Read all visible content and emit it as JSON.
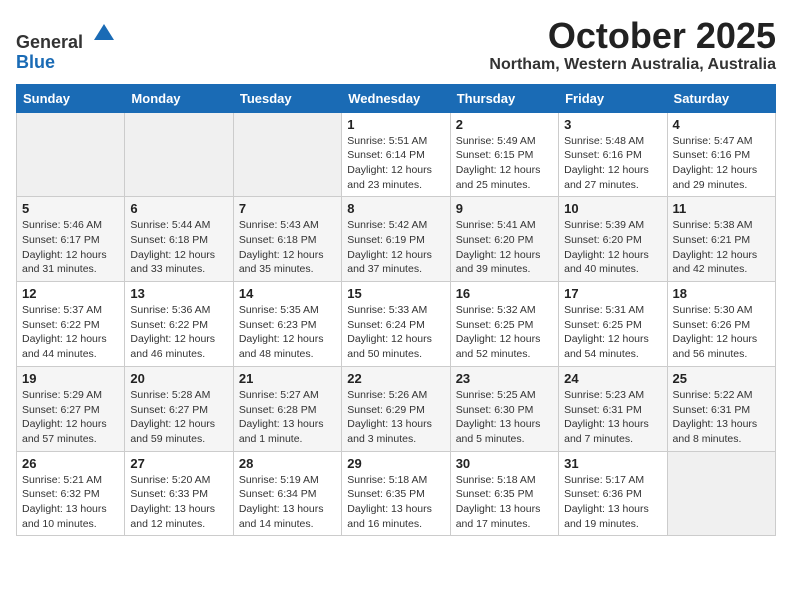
{
  "header": {
    "logo_line1": "General",
    "logo_line2": "Blue",
    "month": "October 2025",
    "location": "Northam, Western Australia, Australia"
  },
  "days_of_week": [
    "Sunday",
    "Monday",
    "Tuesday",
    "Wednesday",
    "Thursday",
    "Friday",
    "Saturday"
  ],
  "weeks": [
    [
      {
        "day": "",
        "info": ""
      },
      {
        "day": "",
        "info": ""
      },
      {
        "day": "",
        "info": ""
      },
      {
        "day": "1",
        "info": "Sunrise: 5:51 AM\nSunset: 6:14 PM\nDaylight: 12 hours\nand 23 minutes."
      },
      {
        "day": "2",
        "info": "Sunrise: 5:49 AM\nSunset: 6:15 PM\nDaylight: 12 hours\nand 25 minutes."
      },
      {
        "day": "3",
        "info": "Sunrise: 5:48 AM\nSunset: 6:16 PM\nDaylight: 12 hours\nand 27 minutes."
      },
      {
        "day": "4",
        "info": "Sunrise: 5:47 AM\nSunset: 6:16 PM\nDaylight: 12 hours\nand 29 minutes."
      }
    ],
    [
      {
        "day": "5",
        "info": "Sunrise: 5:46 AM\nSunset: 6:17 PM\nDaylight: 12 hours\nand 31 minutes."
      },
      {
        "day": "6",
        "info": "Sunrise: 5:44 AM\nSunset: 6:18 PM\nDaylight: 12 hours\nand 33 minutes."
      },
      {
        "day": "7",
        "info": "Sunrise: 5:43 AM\nSunset: 6:18 PM\nDaylight: 12 hours\nand 35 minutes."
      },
      {
        "day": "8",
        "info": "Sunrise: 5:42 AM\nSunset: 6:19 PM\nDaylight: 12 hours\nand 37 minutes."
      },
      {
        "day": "9",
        "info": "Sunrise: 5:41 AM\nSunset: 6:20 PM\nDaylight: 12 hours\nand 39 minutes."
      },
      {
        "day": "10",
        "info": "Sunrise: 5:39 AM\nSunset: 6:20 PM\nDaylight: 12 hours\nand 40 minutes."
      },
      {
        "day": "11",
        "info": "Sunrise: 5:38 AM\nSunset: 6:21 PM\nDaylight: 12 hours\nand 42 minutes."
      }
    ],
    [
      {
        "day": "12",
        "info": "Sunrise: 5:37 AM\nSunset: 6:22 PM\nDaylight: 12 hours\nand 44 minutes."
      },
      {
        "day": "13",
        "info": "Sunrise: 5:36 AM\nSunset: 6:22 PM\nDaylight: 12 hours\nand 46 minutes."
      },
      {
        "day": "14",
        "info": "Sunrise: 5:35 AM\nSunset: 6:23 PM\nDaylight: 12 hours\nand 48 minutes."
      },
      {
        "day": "15",
        "info": "Sunrise: 5:33 AM\nSunset: 6:24 PM\nDaylight: 12 hours\nand 50 minutes."
      },
      {
        "day": "16",
        "info": "Sunrise: 5:32 AM\nSunset: 6:25 PM\nDaylight: 12 hours\nand 52 minutes."
      },
      {
        "day": "17",
        "info": "Sunrise: 5:31 AM\nSunset: 6:25 PM\nDaylight: 12 hours\nand 54 minutes."
      },
      {
        "day": "18",
        "info": "Sunrise: 5:30 AM\nSunset: 6:26 PM\nDaylight: 12 hours\nand 56 minutes."
      }
    ],
    [
      {
        "day": "19",
        "info": "Sunrise: 5:29 AM\nSunset: 6:27 PM\nDaylight: 12 hours\nand 57 minutes."
      },
      {
        "day": "20",
        "info": "Sunrise: 5:28 AM\nSunset: 6:27 PM\nDaylight: 12 hours\nand 59 minutes."
      },
      {
        "day": "21",
        "info": "Sunrise: 5:27 AM\nSunset: 6:28 PM\nDaylight: 13 hours\nand 1 minute."
      },
      {
        "day": "22",
        "info": "Sunrise: 5:26 AM\nSunset: 6:29 PM\nDaylight: 13 hours\nand 3 minutes."
      },
      {
        "day": "23",
        "info": "Sunrise: 5:25 AM\nSunset: 6:30 PM\nDaylight: 13 hours\nand 5 minutes."
      },
      {
        "day": "24",
        "info": "Sunrise: 5:23 AM\nSunset: 6:31 PM\nDaylight: 13 hours\nand 7 minutes."
      },
      {
        "day": "25",
        "info": "Sunrise: 5:22 AM\nSunset: 6:31 PM\nDaylight: 13 hours\nand 8 minutes."
      }
    ],
    [
      {
        "day": "26",
        "info": "Sunrise: 5:21 AM\nSunset: 6:32 PM\nDaylight: 13 hours\nand 10 minutes."
      },
      {
        "day": "27",
        "info": "Sunrise: 5:20 AM\nSunset: 6:33 PM\nDaylight: 13 hours\nand 12 minutes."
      },
      {
        "day": "28",
        "info": "Sunrise: 5:19 AM\nSunset: 6:34 PM\nDaylight: 13 hours\nand 14 minutes."
      },
      {
        "day": "29",
        "info": "Sunrise: 5:18 AM\nSunset: 6:35 PM\nDaylight: 13 hours\nand 16 minutes."
      },
      {
        "day": "30",
        "info": "Sunrise: 5:18 AM\nSunset: 6:35 PM\nDaylight: 13 hours\nand 17 minutes."
      },
      {
        "day": "31",
        "info": "Sunrise: 5:17 AM\nSunset: 6:36 PM\nDaylight: 13 hours\nand 19 minutes."
      },
      {
        "day": "",
        "info": ""
      }
    ]
  ]
}
